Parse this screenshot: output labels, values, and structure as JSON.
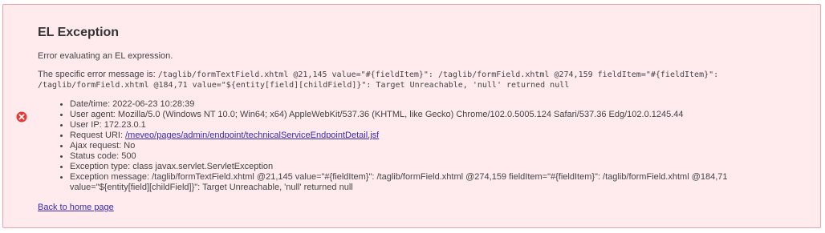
{
  "title": "EL Exception",
  "summary": "Error evaluating an EL expression.",
  "specific": {
    "prefix": "The specific error message is: ",
    "message_line1": "/taglib/formTextField.xhtml @21,145 value=\"#{fieldItem}\": /taglib/formField.xhtml @274,159 fieldItem=\"#{fieldItem}\":",
    "message_line2": "/taglib/formField.xhtml @184,71 value=\"${entity[field][childField]}\": Target Unreachable, 'null' returned null"
  },
  "icons": {
    "error": "error-circle-icon",
    "error_color": "#e53935"
  },
  "details": {
    "datetime": "Date/time: 2022-06-23 10:28:39",
    "user_agent": "User agent: Mozilla/5.0 (Windows NT 10.0; Win64; x64) AppleWebKit/537.36 (KHTML, like Gecko) Chrome/102.0.5005.124 Safari/537.36 Edg/102.0.1245.44",
    "user_ip": "User IP: 172.23.0.1",
    "request_uri_label": "Request URI: ",
    "request_uri_link": "/meveo/pages/admin/endpoint/technicalServiceEndpointDetail.jsf",
    "ajax": "Ajax request: No",
    "status": "Status code: 500",
    "exception_type": "Exception type: class javax.servlet.ServletException",
    "exception_message_line1": "Exception message: /taglib/formTextField.xhtml @21,145 value=\"#{fieldItem}\": /taglib/formField.xhtml @274,159 fieldItem=\"#{fieldItem}\": /taglib/formField.xhtml @184,71",
    "exception_message_line2": "value=\"${entity[field][childField]}\": Target Unreachable, 'null' returned null"
  },
  "home_link": "Back to home page"
}
